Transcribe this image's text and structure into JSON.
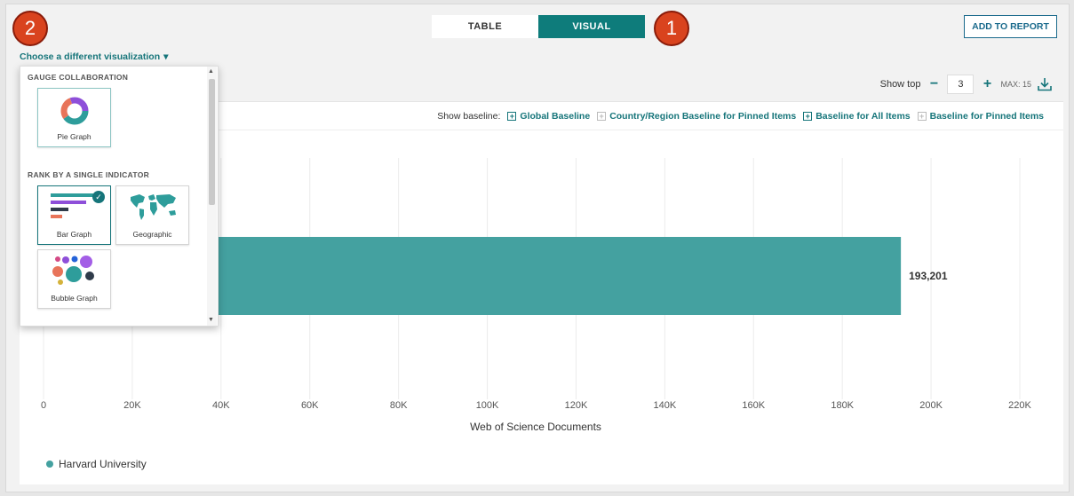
{
  "view_toggle": {
    "table_label": "TABLE",
    "visual_label": "VISUAL",
    "active": "VISUAL"
  },
  "markers": {
    "one": "1",
    "two": "2"
  },
  "header": {
    "add_to_report": "ADD TO REPORT",
    "choose_viz": "Choose a different visualization",
    "choose_caret": "▾"
  },
  "controls": {
    "show_top_label": "Show top",
    "minus": "−",
    "show_top_value": "3",
    "plus": "+",
    "max_label": "MAX: 15",
    "download_icon": "download-icon"
  },
  "baseline": {
    "label": "Show baseline:",
    "items": [
      {
        "label": "Global Baseline",
        "enabled": true,
        "box": "+"
      },
      {
        "label": "Country/Region Baseline for Pinned Items",
        "enabled": false,
        "box": "+"
      },
      {
        "label": "Baseline for All Items",
        "enabled": true,
        "box": "+"
      },
      {
        "label": "Baseline for Pinned Items",
        "enabled": false,
        "box": "+"
      }
    ]
  },
  "dropdown": {
    "section1": "GAUGE COLLABORATION",
    "section2": "RANK BY A SINGLE INDICATOR",
    "tiles": {
      "pie": "Pie Graph",
      "bar": "Bar Graph",
      "geo": "Geographic",
      "bubble": "Bubble Graph"
    },
    "selected": "Bar Graph",
    "check": "✓",
    "scroll_up": "▲",
    "scroll_down": "▼"
  },
  "colors": {
    "accent": "#16757a",
    "bar": "#44a1a0",
    "marker": "#d9431e"
  },
  "chart_data": {
    "type": "bar",
    "orientation": "horizontal",
    "categories": [
      "Harvard University"
    ],
    "series": [
      {
        "name": "Harvard University",
        "values": [
          193201
        ]
      }
    ],
    "value_labels": [
      "193,201"
    ],
    "xlabel": "Web of Science Documents",
    "xlim": [
      0,
      220000
    ],
    "xticks": [
      0,
      20000,
      40000,
      60000,
      80000,
      100000,
      120000,
      140000,
      160000,
      180000,
      200000,
      220000
    ],
    "xtick_labels": [
      "0",
      "20K",
      "40K",
      "60K",
      "80K",
      "100K",
      "120K",
      "140K",
      "160K",
      "180K",
      "200K",
      "220K"
    ],
    "grid": true,
    "legend": "bottom-left"
  }
}
